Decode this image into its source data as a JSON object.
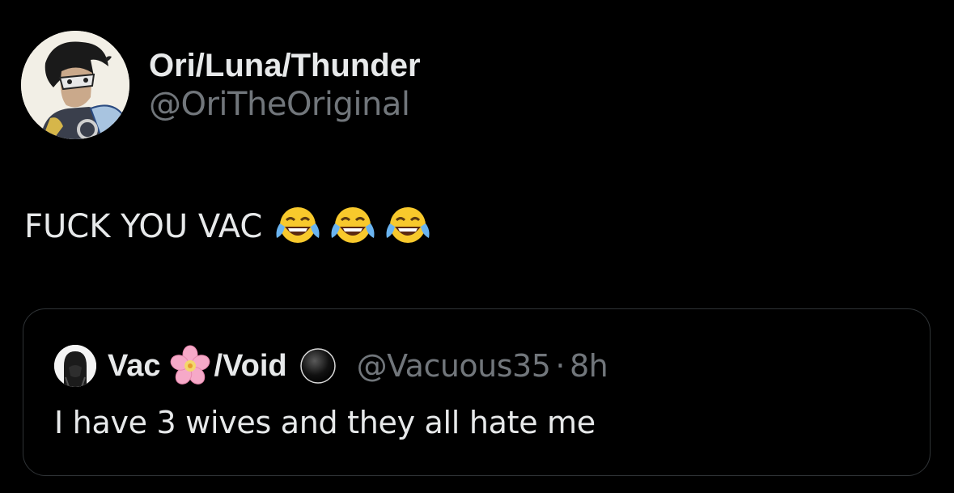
{
  "tweet": {
    "author": {
      "display_name": "Ori/Luna/Thunder",
      "handle": "@OriTheOriginal",
      "avatar_icon": "avatar-cartoon-character"
    },
    "text": "FUCK YOU VAC",
    "emojis": [
      "face-with-tears-of-joy",
      "face-with-tears-of-joy",
      "face-with-tears-of-joy"
    ]
  },
  "quote": {
    "author": {
      "display_name_part1": "Vac",
      "display_name_part2": "/Void",
      "name_emoji": "cherry-blossom",
      "badge_icon": "black-circle",
      "handle": "@Vacuous35",
      "separator": "·",
      "time": "8h"
    },
    "text": "I have 3 wives and they all hate me"
  },
  "colors": {
    "background": "#000000",
    "text": "#e7e9ea",
    "secondary": "#71767b",
    "border": "#2f3336"
  }
}
